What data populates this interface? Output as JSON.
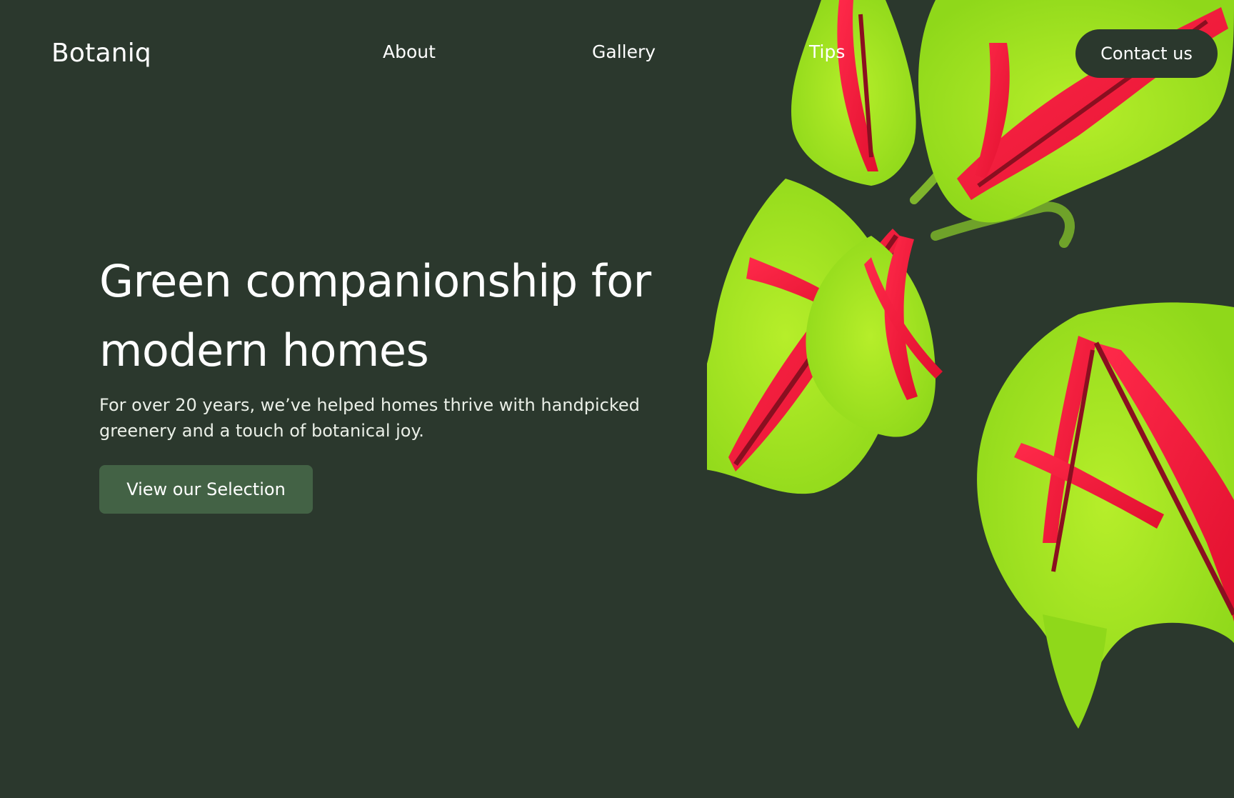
{
  "brand": {
    "name": "Botaniq"
  },
  "nav": {
    "items": [
      {
        "label": "About"
      },
      {
        "label": "Gallery"
      },
      {
        "label": "Tips"
      }
    ],
    "contact_label": "Contact us"
  },
  "hero": {
    "title_line1": "Green companionship for",
    "title_line2": "modern homes",
    "subtitle": "For over 20 years, we’ve helped homes thrive with handpicked greenery and a touch of botanical joy.",
    "cta_label": "View our Selection"
  },
  "colors": {
    "background": "#2b382d",
    "cta_button": "#436245",
    "leaf_green": "#9be21d",
    "leaf_red": "#ff1a3e",
    "leaf_dark": "#7a0e1c"
  },
  "images": {
    "plant": "coleus-plant-leaves"
  }
}
